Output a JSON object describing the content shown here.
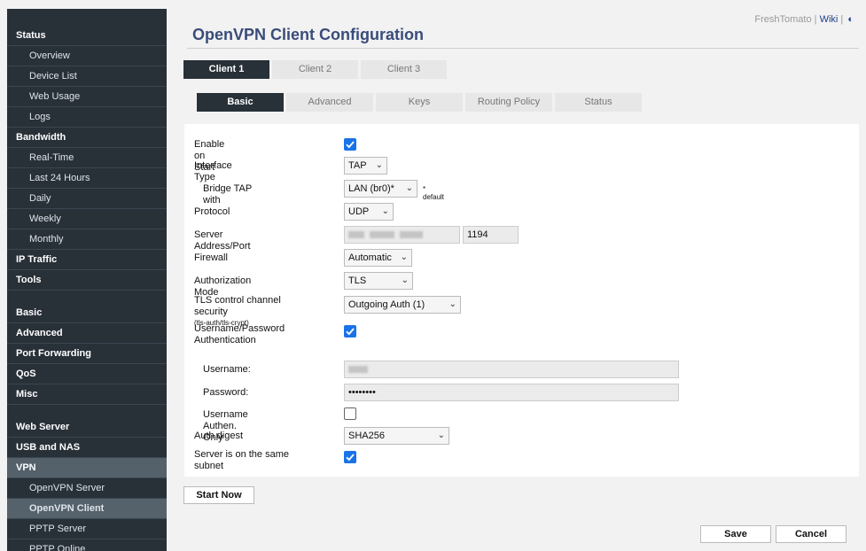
{
  "brand": {
    "name": "FreshTomato",
    "separator": "|",
    "wiki": "Wiki",
    "theme_glyph": "◐"
  },
  "sidebar": {
    "items": [
      {
        "label": "Status",
        "type": "cat"
      },
      {
        "label": "Overview",
        "type": "sub"
      },
      {
        "label": "Device List",
        "type": "sub"
      },
      {
        "label": "Web Usage",
        "type": "sub"
      },
      {
        "label": "Logs",
        "type": "sub"
      },
      {
        "label": "Bandwidth",
        "type": "cat"
      },
      {
        "label": "Real-Time",
        "type": "sub"
      },
      {
        "label": "Last 24 Hours",
        "type": "sub"
      },
      {
        "label": "Daily",
        "type": "sub"
      },
      {
        "label": "Weekly",
        "type": "sub"
      },
      {
        "label": "Monthly",
        "type": "sub"
      },
      {
        "label": "IP Traffic",
        "type": "cat"
      },
      {
        "label": "Tools",
        "type": "cat"
      },
      {
        "label": "Basic",
        "type": "cat"
      },
      {
        "label": "Advanced",
        "type": "cat"
      },
      {
        "label": "Port Forwarding",
        "type": "cat"
      },
      {
        "label": "QoS",
        "type": "cat"
      },
      {
        "label": "Misc",
        "type": "cat"
      },
      {
        "label": "Web Server",
        "type": "cat"
      },
      {
        "label": "USB and NAS",
        "type": "cat"
      },
      {
        "label": "VPN",
        "type": "cat"
      },
      {
        "label": "OpenVPN Server",
        "type": "sub"
      },
      {
        "label": "OpenVPN Client",
        "type": "sub"
      },
      {
        "label": "PPTP Server",
        "type": "sub"
      },
      {
        "label": "PPTP Online",
        "type": "sub"
      }
    ]
  },
  "page": {
    "title": "OpenVPN Client Configuration"
  },
  "client_tabs": [
    "Client 1",
    "Client 2",
    "Client 3"
  ],
  "sub_tabs": [
    "Basic",
    "Advanced",
    "Keys",
    "Routing Policy",
    "Status"
  ],
  "form": {
    "enable_on_start": {
      "label": "Enable on Start",
      "checked": true
    },
    "interface_type": {
      "label": "Interface Type",
      "value": "TAP"
    },
    "bridge_tap": {
      "label": "Bridge TAP with",
      "value": "LAN (br0)*",
      "note": "* default"
    },
    "protocol": {
      "label": "Protocol",
      "value": "UDP"
    },
    "server": {
      "label": "Server Address/Port",
      "port": "1194"
    },
    "firewall": {
      "label": "Firewall",
      "value": "Automatic"
    },
    "auth_mode": {
      "label": "Authorization Mode",
      "value": "TLS"
    },
    "tls_control": {
      "label": "TLS control channel security",
      "sublabel": "(tls-auth/tls-crypt)",
      "value": "Outgoing Auth (1)"
    },
    "userpass": {
      "label": "Username/Password Authentication",
      "checked": true
    },
    "username": {
      "label": "Username:"
    },
    "password": {
      "label": "Password:",
      "value": "••••••••"
    },
    "username_only": {
      "label": "Username Authen. Only",
      "checked": false
    },
    "auth_digest": {
      "label": "Auth digest",
      "value": "SHA256"
    },
    "same_subnet": {
      "label": "Server is on the same subnet",
      "checked": true
    }
  },
  "buttons": {
    "start_now": "Start Now",
    "save": "Save",
    "cancel": "Cancel"
  },
  "colors": {
    "sidebar_bg": "#283038",
    "active_tab": "#283038",
    "title": "#394c7a",
    "checkbox": "#1a73e8"
  }
}
